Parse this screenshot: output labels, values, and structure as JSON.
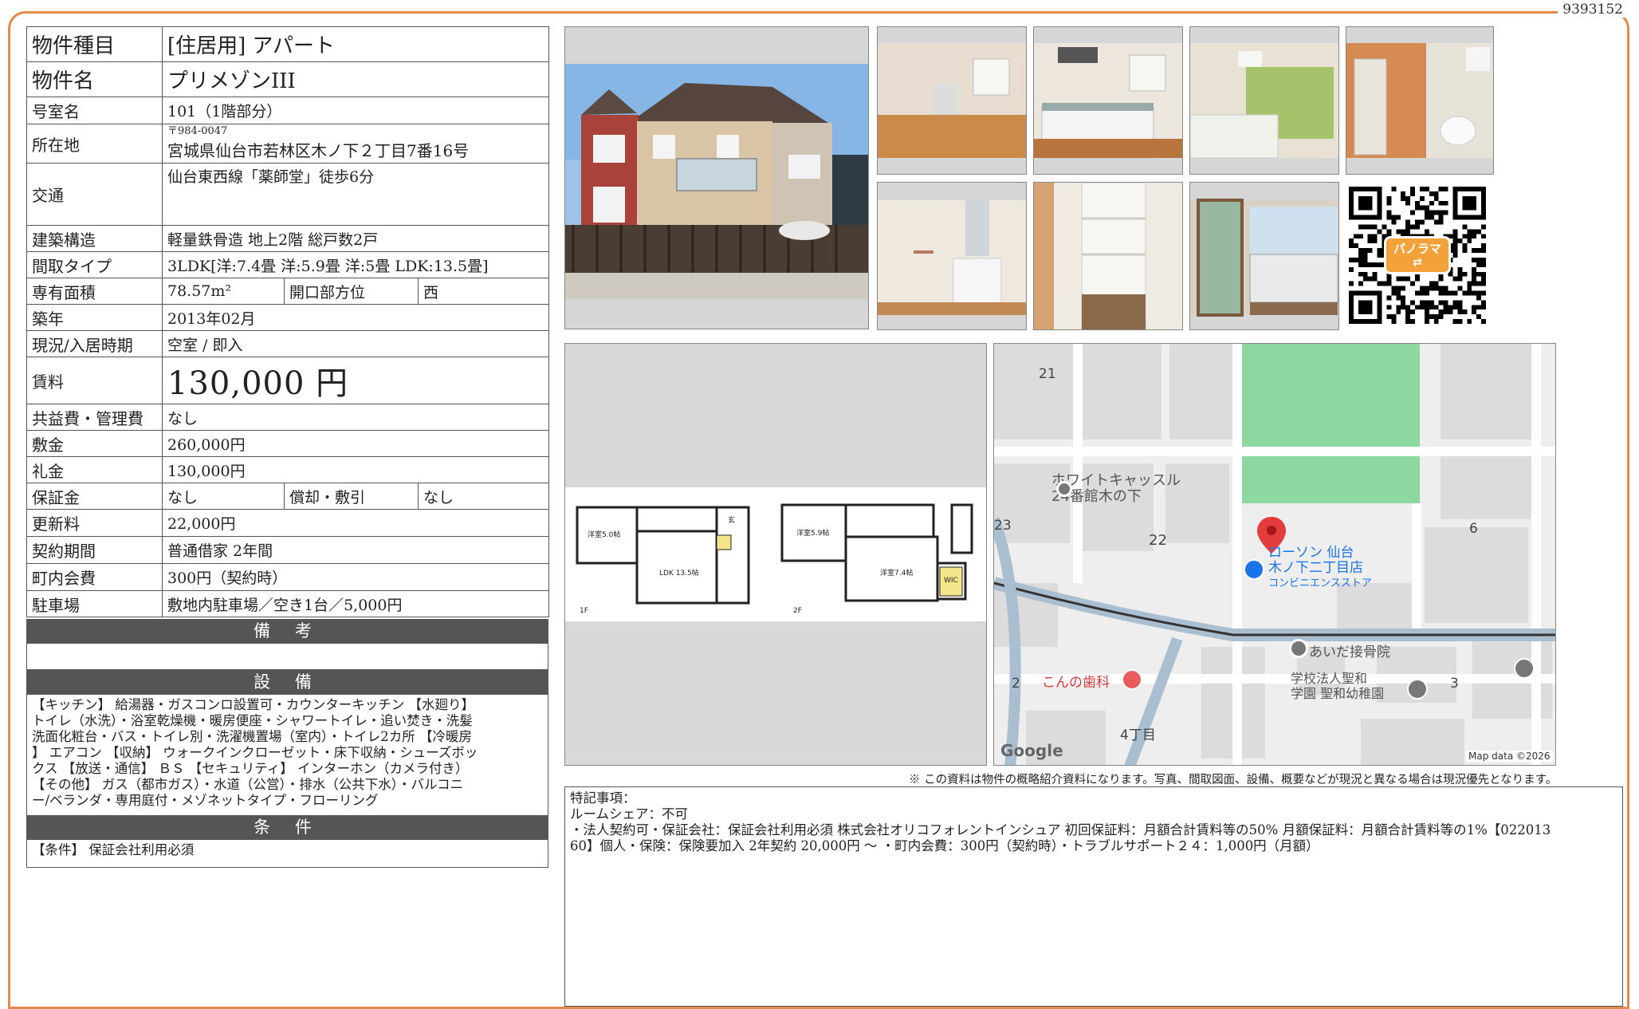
{
  "doc_id": "9393152",
  "info": {
    "type_label": "物件種目",
    "type_value": "[住居用]  アパート",
    "name_label": "物件名",
    "name_value": "プリメゾンIII",
    "room_label": "号室名",
    "room_value": "101（1階部分）",
    "addr_label": "所在地",
    "addr_zip": "〒984-0047",
    "addr_value": "宮城県仙台市若林区木ノ下２丁目7番16号",
    "transit_label": "交通",
    "transit_value": "仙台東西線「薬師堂」徒歩6分",
    "struct_label": "建築構造",
    "struct_value": "軽量鉄骨造 地上2階 総戸数2戸",
    "layout_label": "間取タイプ",
    "layout_value": "3LDK[洋:7.4畳 洋:5.9畳 洋:5畳 LDK:13.5畳]",
    "area_label": "専有面積",
    "area_value": "78.57m²",
    "dir_label": "開口部方位",
    "dir_value": "西",
    "built_label": "築年",
    "built_value": "2013年02月",
    "status_label": "現況/入居時期",
    "status_value": "空室 / 即入",
    "rent_label": "賃料",
    "rent_value": "130,000 円",
    "common_label": "共益費・管理費",
    "common_value": "なし",
    "deposit_label": "敷金",
    "deposit_value": "260,000円",
    "key_label": "礼金",
    "key_value": "130,000円",
    "guarantee_label": "保証金",
    "guarantee_value": "なし",
    "amort_label": "償却・敷引",
    "amort_value": "なし",
    "renew_label": "更新料",
    "renew_value": "22,000円",
    "contract_label": "契約期間",
    "contract_value": "普通借家 2年間",
    "town_label": "町内会費",
    "town_value": "300円（契約時）",
    "parking_label": "駐車場",
    "parking_value": "敷地内駐車場／空き1台／5,000円"
  },
  "sections": {
    "remarks_title": "備 考",
    "remarks_text": "",
    "equip_title": "設 備",
    "equip_lines": [
      "【キッチン】 給湯器・ガスコンロ設置可・カウンターキッチン 【水廻り】",
      "トイレ（水洗）・浴室乾燥機・暖房便座・シャワートイレ・追い焚き・洗髪",
      "洗面化粧台・バス・トイレ別・洗濯機置場（室内）・トイレ2カ所 【冷暖房",
      "】 エアコン 【収納】 ウォークインクローゼット・床下収納・シューズボッ",
      "クス 【放送・通信】 ＢＳ 【セキュリティ】 インターホン（カメラ付き）",
      "【その他】 ガス（都市ガス）・水道（公営）・排水（公共下水）・バルコニ",
      "ー/ベランダ・専用庭付・メゾネットタイプ・フローリング"
    ],
    "cond_title": "条 件",
    "cond_text": "【条件】 保証会社利用必須"
  },
  "qr": {
    "badge": "パノラマ"
  },
  "floorplan": {
    "floor1": "1F",
    "floor2": "2F",
    "r1": "洋室5.0帖",
    "r2": "LDK 13.5帖",
    "r3": "洋室5.9帖",
    "r4": "洋室7.4帖",
    "r5": "WIC",
    "r6": "玄"
  },
  "map": {
    "labels": {
      "n21": "21",
      "n23": "23",
      "n22": "22",
      "n6": "6",
      "n2": "2",
      "n3": "3",
      "n4": "4丁目",
      "white_castle1": "ホワイトキャッスル",
      "white_castle2": "24番館木の下",
      "lawson1": "ローソン 仙台",
      "lawson2": "木ノ下二丁目店",
      "lawson3": "コンビニエンスストア",
      "aida": "あいだ接骨院",
      "konno": "こんの歯科",
      "school1": "学校法人聖和",
      "school2": "学園 聖和幼稚園",
      "google": "Google",
      "mapdata": "Map data ©2026"
    }
  },
  "note": "※ この資料は物件の概略紹介資料になります。写真、間取図面、設備、概要などが現況と異なる場合は現況優先となります。",
  "tokki": {
    "title": "特記事項：",
    "line1": "ルームシェア：不可",
    "line2": "・法人契約可・保証会社：保証会社利用必須 株式会社オリコフォレントインシュア 初回保証料：月額合計賃料等の50% 月額保証料：月額合計賃料等の1%【022013",
    "line3": "60】個人・保険：保険要加入 2年契約 20,000円 〜 ・町内会費：300円（契約時）・トラブルサポート２４：1,000円（月額）"
  }
}
